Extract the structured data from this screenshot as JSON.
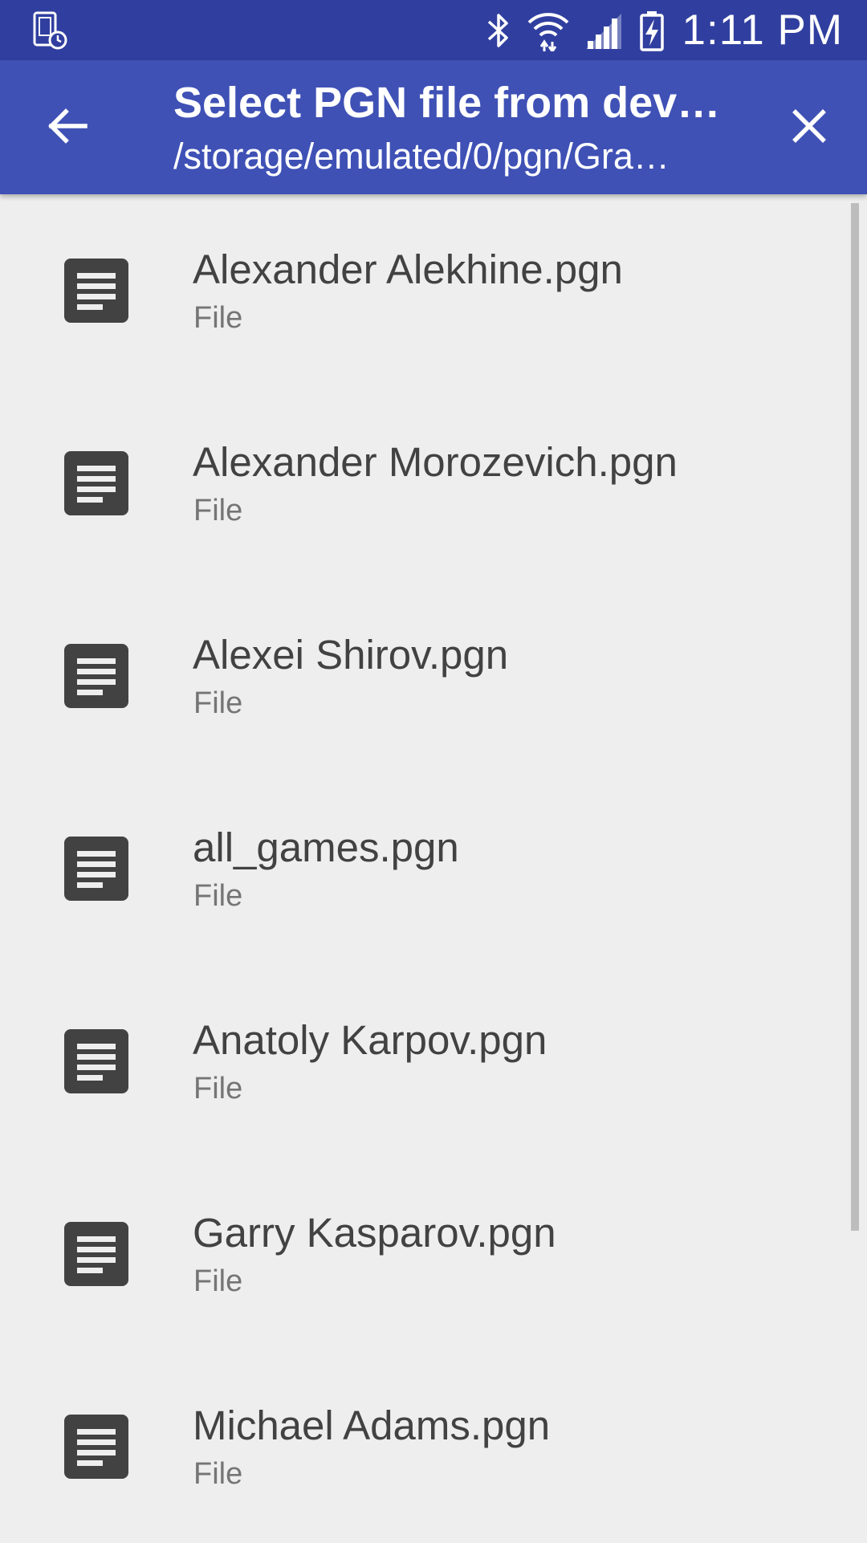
{
  "status_bar": {
    "time": "1:11 PM",
    "icons": [
      "device-schedule-icon",
      "bluetooth-icon",
      "wifi-icon",
      "signal-icon",
      "battery-charging-icon"
    ]
  },
  "app_bar": {
    "title": "Select PGN file from dev…",
    "subtitle": "/storage/emulated/0/pgn/Gra…",
    "back_icon": "arrow-back-icon",
    "close_icon": "close-icon"
  },
  "files": [
    {
      "name": "Alexander Alekhine.pgn",
      "type": "File"
    },
    {
      "name": "Alexander Morozevich.pgn",
      "type": "File"
    },
    {
      "name": "Alexei Shirov.pgn",
      "type": "File"
    },
    {
      "name": "all_games.pgn",
      "type": "File"
    },
    {
      "name": "Anatoly Karpov.pgn",
      "type": "File"
    },
    {
      "name": "Garry Kasparov.pgn",
      "type": "File"
    },
    {
      "name": "Michael Adams.pgn",
      "type": "File"
    }
  ],
  "colors": {
    "status_bar": "#303f9f",
    "app_bar": "#3f51b5",
    "background": "#eeeeee",
    "icon": "#424242"
  }
}
